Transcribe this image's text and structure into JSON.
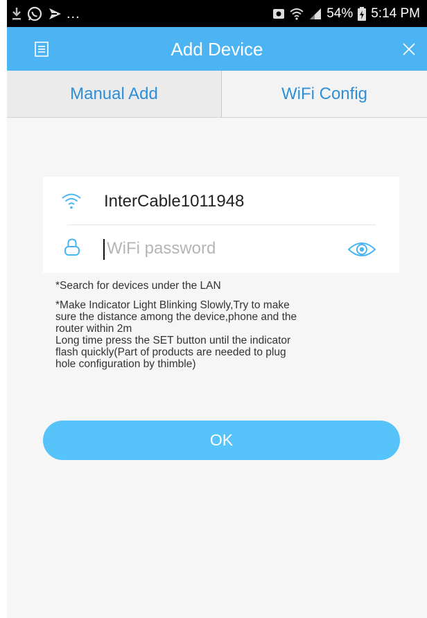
{
  "status_bar": {
    "left_icons": [
      "download-icon",
      "whatsapp-icon",
      "send-icon"
    ],
    "ellipsis": "...",
    "battery_percent": "54%",
    "time": "5:14 PM"
  },
  "header": {
    "title": "Add Device"
  },
  "tabs": [
    {
      "label": "Manual Add"
    },
    {
      "label": "WiFi Config"
    }
  ],
  "wifi_form": {
    "ssid": "InterCable1011948",
    "password_value": "",
    "password_placeholder": "WiFi password"
  },
  "hints": {
    "line1": "*Search for devices under the LAN",
    "line2": "*Make Indicator Light Blinking Slowly,Try to make\nsure the distance among the device,phone and the\nrouter within 2m\nLong time press the SET button until the indicator\nflash quickly(Part of products are needed to plug\nhole configuration by thimble)"
  },
  "ok_button": {
    "label": "OK"
  },
  "colors": {
    "accent": "#4db4f4",
    "button": "#56c3fb",
    "tab_text": "#2f8fd6",
    "background": "#f6f6f6"
  }
}
